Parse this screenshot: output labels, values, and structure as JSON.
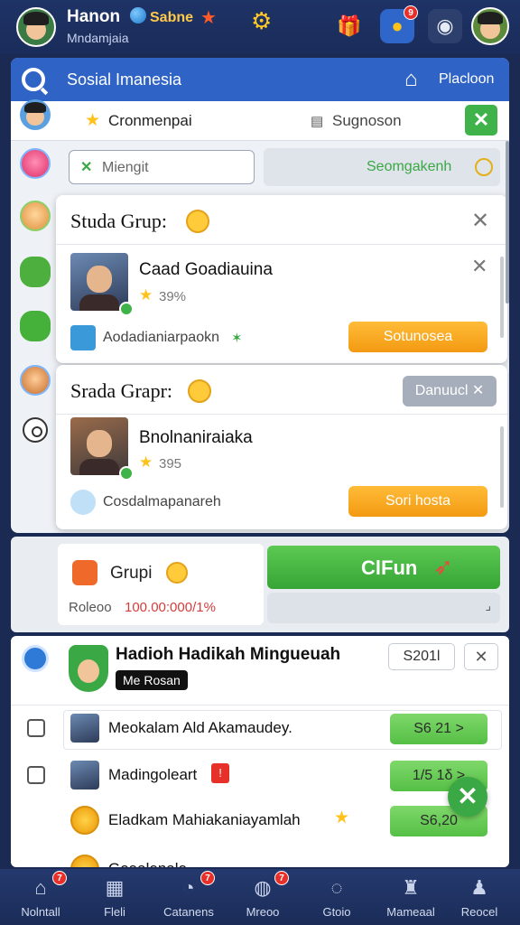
{
  "topbar": {
    "user_name": "Hanon",
    "brand": "Sabne",
    "subtitle": "Mndamjaia",
    "chat_badge": "9"
  },
  "panel": {
    "title": "Sosial Imanesia",
    "right_label": "Placloon",
    "strip": {
      "left_label": "Cronmenpai",
      "right_label": "Sugnoson"
    },
    "filter": {
      "input_value": "Miengit",
      "status_label": "Seomgakenh"
    },
    "cards": [
      {
        "title": "Studa Grup:",
        "person_name": "Caad Goadiauina",
        "rating": "39%",
        "footer_text": "Aodadianiarpaokn",
        "action_label": "Sotunosea"
      },
      {
        "title": "Srada Grapr:",
        "chip_label": "Danuucl",
        "person_name": "Bnolnaniraiaka",
        "rating": "395",
        "footer_text": "Cosdalmapanareh",
        "action_label": "Sori hosta"
      }
    ]
  },
  "group": {
    "label": "Grupi",
    "stat_label": "Roleoo",
    "stat_value": "100.00:000/1%",
    "cta_label": "ClFun"
  },
  "list": {
    "title": "Hadioh Hadikah Mingueuah",
    "tag": "Me Rosan",
    "code": "S201l",
    "items": [
      {
        "name": "Meokalam Ald Akamaudey.",
        "amount": "S6 21 >"
      },
      {
        "name": "Madingoleart",
        "amount": "1/5 1δ >"
      },
      {
        "name": "Eladkam Mahiakaniayamlah",
        "amount": "S6,20"
      },
      {
        "name": "Goaalenalo",
        "amount": ""
      }
    ]
  },
  "nav": {
    "items": [
      {
        "label": "Nolntall",
        "badge": "7"
      },
      {
        "label": "Fleli",
        "badge": ""
      },
      {
        "label": "Catanens",
        "badge": "7"
      },
      {
        "label": "Mreoo",
        "badge": "7"
      },
      {
        "label": "Gtoio",
        "badge": ""
      },
      {
        "label": "Mameaal",
        "badge": ""
      },
      {
        "label": "Reocel",
        "badge": ""
      }
    ]
  },
  "colors": {
    "topbar_bg": "#1e3366",
    "panel_header": "#2f63c5",
    "accent_green": "#3fb34a",
    "accent_orange": "#f39a12",
    "badge_red": "#e8302b"
  }
}
